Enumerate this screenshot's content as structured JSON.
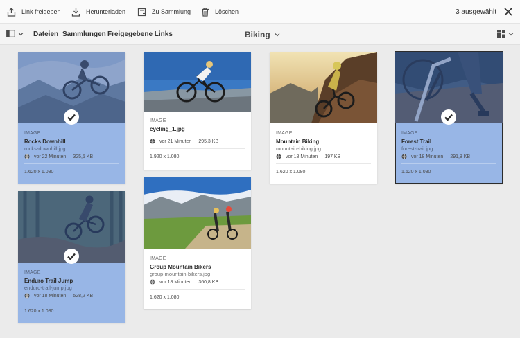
{
  "actions": {
    "share_link": "Link freigeben",
    "download": "Herunterladen",
    "to_collection": "Zu Sammlung",
    "delete": "Löschen",
    "selected_count": "3 ausgewählt"
  },
  "nav": {
    "files": "Dateien",
    "collections": "Sammlungen",
    "shared_links": "Freigegebene Links",
    "current_folder": "Biking"
  },
  "colors": {
    "selected_card": "#98b6e6",
    "selection_overlay": "#375faa",
    "checkmark": "#ffffff"
  },
  "assets": [
    {
      "type": "IMAGE",
      "title": "Rocks Downhill",
      "filename": "rocks-downhill.jpg",
      "modified": "vor 22 Minuten",
      "size": "325,5 KB",
      "dimensions": "1.620 x 1.080",
      "selected": true,
      "focused": false
    },
    {
      "type": "IMAGE",
      "title": "cycling_1.jpg",
      "filename": "",
      "modified": "vor 21 Minuten",
      "size": "295,3 KB",
      "dimensions": "1.920 x 1.080",
      "selected": false,
      "focused": false
    },
    {
      "type": "IMAGE",
      "title": "Mountain Biking",
      "filename": "mountain-biking.jpg",
      "modified": "vor 18 Minuten",
      "size": "197 KB",
      "dimensions": "1.620 x 1.080",
      "selected": false,
      "focused": false
    },
    {
      "type": "IMAGE",
      "title": "Forest Trail",
      "filename": "forest-trail.jpg",
      "modified": "vor 18 Minuten",
      "size": "291,8 KB",
      "dimensions": "1.620 x 1.080",
      "selected": true,
      "focused": true
    },
    {
      "type": "IMAGE",
      "title": "Enduro Trail Jump",
      "filename": "enduro-trail-jump.jpg",
      "modified": "vor 18 Minuten",
      "size": "528,2 KB",
      "dimensions": "1.620 x 1.080",
      "selected": true,
      "focused": false
    },
    {
      "type": "IMAGE",
      "title": "Group Mountain Bikers",
      "filename": "group-mountain-bikers.jpg",
      "modified": "vor 18 Minuten",
      "size": "360,8 KB",
      "dimensions": "1.620 x 1.080",
      "selected": false,
      "focused": false
    }
  ]
}
